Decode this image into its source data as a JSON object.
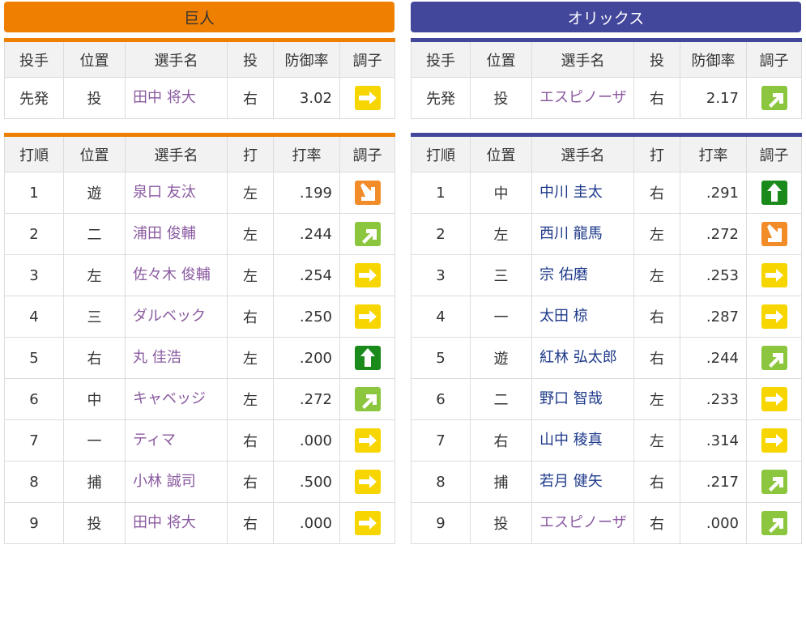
{
  "giants": {
    "team_name": "巨人",
    "pitcher_headers": [
      "投手",
      "位置",
      "選手名",
      "投",
      "防御率",
      "調子"
    ],
    "pitcher": {
      "role": "先発",
      "pos": "投",
      "name": "田中 将大",
      "hand": "右",
      "era": "3.02",
      "cond": "flat"
    },
    "batter_headers": [
      "打順",
      "位置",
      "選手名",
      "打",
      "打率",
      "調子"
    ],
    "batters": [
      {
        "order": "1",
        "pos": "遊",
        "name": "泉口 友汰",
        "hand": "左",
        "avg": ".199",
        "cond": "down"
      },
      {
        "order": "2",
        "pos": "二",
        "name": "浦田 俊輔",
        "hand": "左",
        "avg": ".244",
        "cond": "up"
      },
      {
        "order": "3",
        "pos": "左",
        "name": "佐々木 俊輔",
        "hand": "左",
        "avg": ".254",
        "cond": "flat"
      },
      {
        "order": "4",
        "pos": "三",
        "name": "ダルベック",
        "hand": "右",
        "avg": ".250",
        "cond": "flat"
      },
      {
        "order": "5",
        "pos": "右",
        "name": "丸 佳浩",
        "hand": "左",
        "avg": ".200",
        "cond": "top"
      },
      {
        "order": "6",
        "pos": "中",
        "name": "キャベッジ",
        "hand": "左",
        "avg": ".272",
        "cond": "up"
      },
      {
        "order": "7",
        "pos": "一",
        "name": "ティマ",
        "hand": "右",
        "avg": ".000",
        "cond": "flat"
      },
      {
        "order": "8",
        "pos": "捕",
        "name": "小林 誠司",
        "hand": "右",
        "avg": ".500",
        "cond": "flat"
      },
      {
        "order": "9",
        "pos": "投",
        "name": "田中 将大",
        "hand": "右",
        "avg": ".000",
        "cond": "flat"
      }
    ]
  },
  "orix": {
    "team_name": "オリックス",
    "pitcher_headers": [
      "投手",
      "位置",
      "選手名",
      "投",
      "防御率",
      "調子"
    ],
    "pitcher": {
      "role": "先発",
      "pos": "投",
      "name": "エスピノーザ",
      "hand": "右",
      "era": "2.17",
      "cond": "up"
    },
    "batter_headers": [
      "打順",
      "位置",
      "選手名",
      "打",
      "打率",
      "調子"
    ],
    "batters": [
      {
        "order": "1",
        "pos": "中",
        "name": "中川 圭太",
        "hand": "右",
        "avg": ".291",
        "cond": "top"
      },
      {
        "order": "2",
        "pos": "左",
        "name": "西川 龍馬",
        "hand": "左",
        "avg": ".272",
        "cond": "down"
      },
      {
        "order": "3",
        "pos": "三",
        "name": "宗 佑磨",
        "hand": "左",
        "avg": ".253",
        "cond": "flat"
      },
      {
        "order": "4",
        "pos": "一",
        "name": "太田 椋",
        "hand": "右",
        "avg": ".287",
        "cond": "flat"
      },
      {
        "order": "5",
        "pos": "遊",
        "name": "紅林 弘太郎",
        "hand": "右",
        "avg": ".244",
        "cond": "up"
      },
      {
        "order": "6",
        "pos": "二",
        "name": "野口 智哉",
        "hand": "左",
        "avg": ".233",
        "cond": "flat"
      },
      {
        "order": "7",
        "pos": "右",
        "name": "山中 稜真",
        "hand": "左",
        "avg": ".314",
        "cond": "flat"
      },
      {
        "order": "8",
        "pos": "捕",
        "name": "若月 健矢",
        "hand": "右",
        "avg": ".217",
        "cond": "up"
      },
      {
        "order": "9",
        "pos": "投",
        "name": "エスピノーザ",
        "hand": "右",
        "avg": ".000",
        "cond": "up"
      }
    ]
  },
  "condition_icons": {
    "flat": "arrow-right-icon",
    "up": "arrow-up-right-icon",
    "top": "arrow-up-icon",
    "down": "arrow-down-right-icon"
  },
  "colors": {
    "giants_accent": "#ee7f00",
    "orix_accent": "#43479b",
    "cond_flat": "#f7d600",
    "cond_up": "#8cc63f",
    "cond_top": "#1a8a1a",
    "cond_down": "#f28c28"
  }
}
